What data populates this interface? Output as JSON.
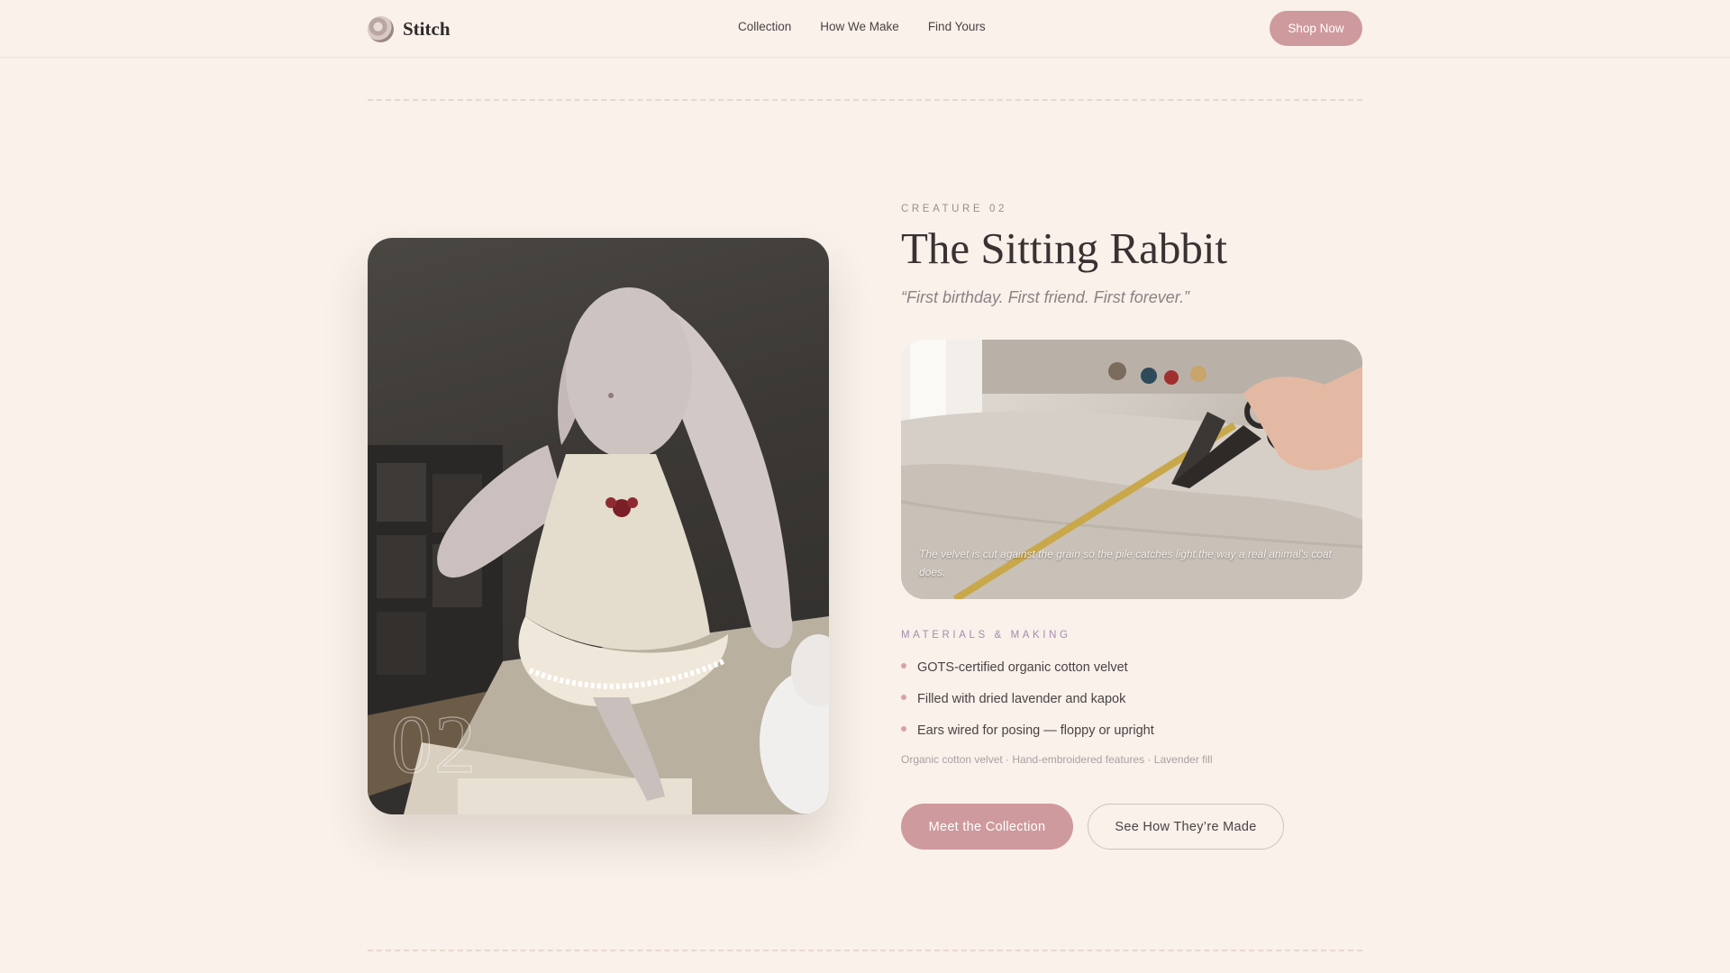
{
  "header": {
    "brand": "Stitch",
    "nav": [
      "Collection",
      "How We Make",
      "Find Yours"
    ],
    "cta": "Shop Now"
  },
  "hero": {
    "number": "02",
    "image_icon": "plush-rabbit-photo"
  },
  "creature": {
    "eyebrow": "CREATURE 02",
    "title": "The Sitting Rabbit",
    "quote": "“First birthday. First friend. First forever.”"
  },
  "craft": {
    "image_icon": "cutting-fabric-photo",
    "caption": "The velvet is cut against the grain so the pile catches light the way a real animal's coat does."
  },
  "materials": {
    "heading": "MATERIALS & MAKING",
    "items": [
      "GOTS-certified organic cotton velvet",
      "Filled with dried lavender and kapok",
      "Ears wired for posing — floppy or upright"
    ],
    "tags": "Organic cotton velvet · Hand-embroidered features · Lavender fill"
  },
  "actions": {
    "primary": "Meet the Collection",
    "secondary": "See How They’re Made"
  },
  "colors": {
    "background": "#f9f1ea",
    "accent": "#cf9a9d",
    "heading_lavender": "#a58bb0"
  }
}
